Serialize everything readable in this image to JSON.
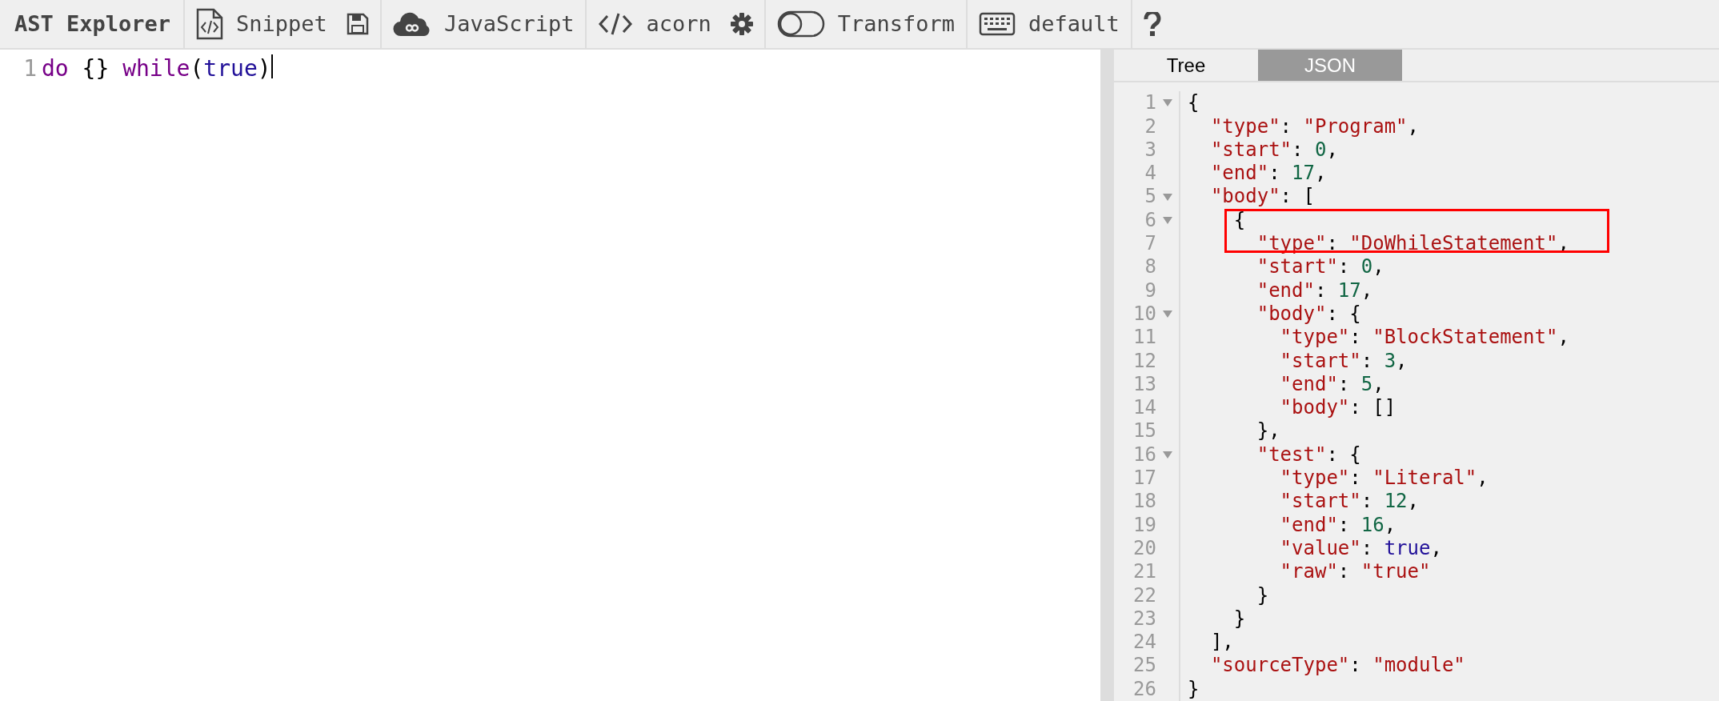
{
  "toolbar": {
    "brand": "AST Explorer",
    "items": [
      {
        "kind": "snippet",
        "label": "Snippet"
      },
      {
        "kind": "save"
      },
      {
        "kind": "language",
        "label": "JavaScript"
      },
      {
        "kind": "parser",
        "label": "acorn"
      },
      {
        "kind": "settings"
      },
      {
        "kind": "transform",
        "label": "Transform",
        "on": false
      },
      {
        "kind": "keymap",
        "label": "default"
      },
      {
        "kind": "help"
      }
    ]
  },
  "editor": {
    "lines": [
      {
        "number": "1",
        "tokens": [
          {
            "kind": "keyword",
            "text": "do"
          },
          {
            "kind": "punct",
            "text": " {} "
          },
          {
            "kind": "keyword",
            "text": "while"
          },
          {
            "kind": "punct",
            "text": "("
          },
          {
            "kind": "atom",
            "text": "true"
          },
          {
            "kind": "punct",
            "text": ")"
          }
        ]
      }
    ]
  },
  "output": {
    "tabs": [
      {
        "label": "Tree",
        "selected": false
      },
      {
        "label": "JSON",
        "selected": true
      }
    ],
    "annotations": [
      {
        "kind": "rectangle",
        "color": "#ff0000"
      }
    ],
    "lines": [
      {
        "number": "1",
        "foldable": true,
        "tokens": [
          {
            "kind": "punct",
            "text": "{"
          }
        ],
        "children": [
          {
            "number": "2",
            "foldable": false,
            "tokens": [
              {
                "kind": "string",
                "text": "\"type\""
              },
              {
                "kind": "punct",
                "text": ": "
              },
              {
                "kind": "string",
                "text": "\"Program\""
              },
              {
                "kind": "punct",
                "text": ","
              }
            ]
          },
          {
            "number": "3",
            "foldable": false,
            "tokens": [
              {
                "kind": "string",
                "text": "\"start\""
              },
              {
                "kind": "punct",
                "text": ": "
              },
              {
                "kind": "number",
                "text": "0"
              },
              {
                "kind": "punct",
                "text": ","
              }
            ]
          },
          {
            "number": "4",
            "foldable": false,
            "tokens": [
              {
                "kind": "string",
                "text": "\"end\""
              },
              {
                "kind": "punct",
                "text": ": "
              },
              {
                "kind": "number",
                "text": "17"
              },
              {
                "kind": "punct",
                "text": ","
              }
            ]
          },
          {
            "number": "5",
            "foldable": true,
            "tokens": [
              {
                "kind": "string",
                "text": "\"body\""
              },
              {
                "kind": "punct",
                "text": ": ["
              }
            ],
            "children": [
              {
                "number": "6",
                "foldable": true,
                "tokens": [
                  {
                    "kind": "punct",
                    "text": "{"
                  }
                ],
                "children": [
                  {
                    "number": "7",
                    "foldable": false,
                    "tokens": [
                      {
                        "kind": "string",
                        "text": "\"type\""
                      },
                      {
                        "kind": "punct",
                        "text": ": "
                      },
                      {
                        "kind": "string",
                        "text": "\"DoWhileStatement\""
                      },
                      {
                        "kind": "punct",
                        "text": ","
                      }
                    ]
                  },
                  {
                    "number": "8",
                    "foldable": false,
                    "tokens": [
                      {
                        "kind": "string",
                        "text": "\"start\""
                      },
                      {
                        "kind": "punct",
                        "text": ": "
                      },
                      {
                        "kind": "number",
                        "text": "0"
                      },
                      {
                        "kind": "punct",
                        "text": ","
                      }
                    ]
                  },
                  {
                    "number": "9",
                    "foldable": false,
                    "tokens": [
                      {
                        "kind": "string",
                        "text": "\"end\""
                      },
                      {
                        "kind": "punct",
                        "text": ": "
                      },
                      {
                        "kind": "number",
                        "text": "17"
                      },
                      {
                        "kind": "punct",
                        "text": ","
                      }
                    ]
                  },
                  {
                    "number": "10",
                    "foldable": true,
                    "tokens": [
                      {
                        "kind": "string",
                        "text": "\"body\""
                      },
                      {
                        "kind": "punct",
                        "text": ": {"
                      }
                    ],
                    "children": [
                      {
                        "number": "11",
                        "foldable": false,
                        "tokens": [
                          {
                            "kind": "string",
                            "text": "\"type\""
                          },
                          {
                            "kind": "punct",
                            "text": ": "
                          },
                          {
                            "kind": "string",
                            "text": "\"BlockStatement\""
                          },
                          {
                            "kind": "punct",
                            "text": ","
                          }
                        ]
                      },
                      {
                        "number": "12",
                        "foldable": false,
                        "tokens": [
                          {
                            "kind": "string",
                            "text": "\"start\""
                          },
                          {
                            "kind": "punct",
                            "text": ": "
                          },
                          {
                            "kind": "number",
                            "text": "3"
                          },
                          {
                            "kind": "punct",
                            "text": ","
                          }
                        ]
                      },
                      {
                        "number": "13",
                        "foldable": false,
                        "tokens": [
                          {
                            "kind": "string",
                            "text": "\"end\""
                          },
                          {
                            "kind": "punct",
                            "text": ": "
                          },
                          {
                            "kind": "number",
                            "text": "5"
                          },
                          {
                            "kind": "punct",
                            "text": ","
                          }
                        ]
                      },
                      {
                        "number": "14",
                        "foldable": false,
                        "tokens": [
                          {
                            "kind": "string",
                            "text": "\"body\""
                          },
                          {
                            "kind": "punct",
                            "text": ": []"
                          }
                        ]
                      }
                    ]
                  },
                  {
                    "number": "15",
                    "foldable": false,
                    "tokens": [
                      {
                        "kind": "punct",
                        "text": "},"
                      }
                    ]
                  },
                  {
                    "number": "16",
                    "foldable": true,
                    "tokens": [
                      {
                        "kind": "string",
                        "text": "\"test\""
                      },
                      {
                        "kind": "punct",
                        "text": ": {"
                      }
                    ],
                    "children": [
                      {
                        "number": "17",
                        "foldable": false,
                        "tokens": [
                          {
                            "kind": "string",
                            "text": "\"type\""
                          },
                          {
                            "kind": "punct",
                            "text": ": "
                          },
                          {
                            "kind": "string",
                            "text": "\"Literal\""
                          },
                          {
                            "kind": "punct",
                            "text": ","
                          }
                        ]
                      },
                      {
                        "number": "18",
                        "foldable": false,
                        "tokens": [
                          {
                            "kind": "string",
                            "text": "\"start\""
                          },
                          {
                            "kind": "punct",
                            "text": ": "
                          },
                          {
                            "kind": "number",
                            "text": "12"
                          },
                          {
                            "kind": "punct",
                            "text": ","
                          }
                        ]
                      },
                      {
                        "number": "19",
                        "foldable": false,
                        "tokens": [
                          {
                            "kind": "string",
                            "text": "\"end\""
                          },
                          {
                            "kind": "punct",
                            "text": ": "
                          },
                          {
                            "kind": "number",
                            "text": "16"
                          },
                          {
                            "kind": "punct",
                            "text": ","
                          }
                        ]
                      },
                      {
                        "number": "20",
                        "foldable": false,
                        "tokens": [
                          {
                            "kind": "string",
                            "text": "\"value\""
                          },
                          {
                            "kind": "punct",
                            "text": ": "
                          },
                          {
                            "kind": "atom",
                            "text": "true"
                          },
                          {
                            "kind": "punct",
                            "text": ","
                          }
                        ]
                      },
                      {
                        "number": "21",
                        "foldable": false,
                        "tokens": [
                          {
                            "kind": "string",
                            "text": "\"raw\""
                          },
                          {
                            "kind": "punct",
                            "text": ": "
                          },
                          {
                            "kind": "string",
                            "text": "\"true\""
                          }
                        ]
                      }
                    ]
                  },
                  {
                    "number": "22",
                    "foldable": false,
                    "tokens": [
                      {
                        "kind": "punct",
                        "text": "}"
                      }
                    ]
                  }
                ]
              },
              {
                "number": "23",
                "foldable": false,
                "tokens": [
                  {
                    "kind": "punct",
                    "text": "}"
                  }
                ]
              }
            ]
          },
          {
            "number": "24",
            "foldable": false,
            "tokens": [
              {
                "kind": "punct",
                "text": "],"
              }
            ]
          },
          {
            "number": "25",
            "foldable": false,
            "tokens": [
              {
                "kind": "string",
                "text": "\"sourceType\""
              },
              {
                "kind": "punct",
                "text": ": "
              },
              {
                "kind": "string",
                "text": "\"module\""
              }
            ]
          }
        ]
      },
      {
        "number": "26",
        "foldable": false,
        "tokens": [
          {
            "kind": "punct",
            "text": "}"
          }
        ]
      }
    ]
  }
}
